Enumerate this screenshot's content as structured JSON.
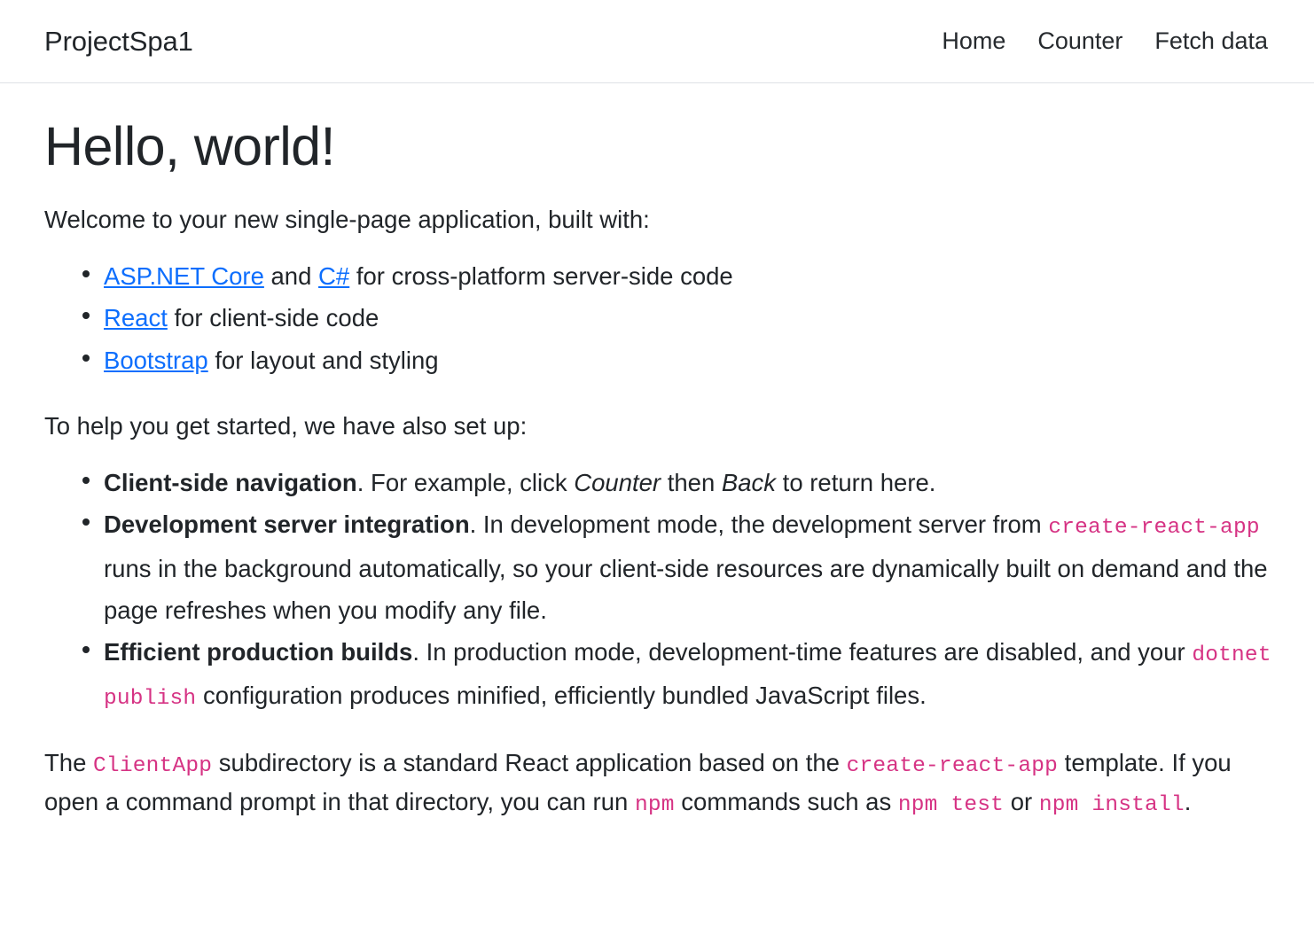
{
  "colors": {
    "link": "#0d6efd",
    "code": "#d63384",
    "text": "#212529",
    "border": "#dee2e6",
    "background": "#ffffff"
  },
  "header": {
    "brand": "ProjectSpa1",
    "nav": [
      {
        "label": "Home"
      },
      {
        "label": "Counter"
      },
      {
        "label": "Fetch data"
      }
    ]
  },
  "main": {
    "title": "Hello, world!",
    "intro": "Welcome to your new single-page application, built with:",
    "tech_list": [
      {
        "link1": "ASP.NET Core",
        "mid": " and ",
        "link2": "C#",
        "tail": " for cross-platform server-side code"
      },
      {
        "link1": "React",
        "tail": " for client-side code"
      },
      {
        "link1": "Bootstrap",
        "tail": " for layout and styling"
      }
    ],
    "setup_intro": "To help you get started, we have also set up:",
    "features": [
      {
        "term": "Client-side navigation",
        "part1": ". For example, click ",
        "em1": "Counter",
        "part2": " then ",
        "em2": "Back",
        "part3": " to return here."
      },
      {
        "term": "Development server integration",
        "part1": ". In development mode, the development server from ",
        "code1": "create-react-app",
        "part2": " runs in the background automatically, so your client-side resources are dynamically built on demand and the page refreshes when you modify any file."
      },
      {
        "term": "Efficient production builds",
        "part1": ". In production mode, development-time features are disabled, and your ",
        "code1": "dotnet publish",
        "part2": " configuration produces minified, efficiently bundled JavaScript files."
      }
    ],
    "closing": {
      "t1": "The ",
      "c1": "ClientApp",
      "t2": " subdirectory is a standard React application based on the ",
      "c2": "create-react-app",
      "t3": " template. If you open a command prompt in that directory, you can run ",
      "c3": "npm",
      "t4": " commands such as ",
      "c4": "npm test",
      "t5": " or ",
      "c5": "npm install",
      "t6": "."
    }
  }
}
